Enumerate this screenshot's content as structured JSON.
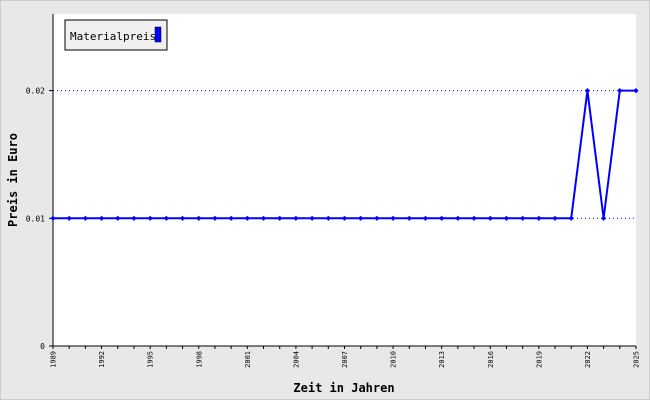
{
  "chart_data": {
    "type": "line",
    "title": "",
    "xlabel": "Zeit in Jahren",
    "ylabel": "Preis in Euro",
    "xlim": [
      1989,
      2025
    ],
    "ylim": [
      0,
      0.026
    ],
    "x_ticks": [
      "1989",
      "1992",
      "1995",
      "1998",
      "2001",
      "2004",
      "2007",
      "2010",
      "2013",
      "2016",
      "2019",
      "2022",
      "2025"
    ],
    "y_ticks": [
      "0",
      "0.01",
      "0.02"
    ],
    "y_tick_values": [
      0,
      0.01,
      0.02
    ],
    "grid": "horizontal-dotted",
    "legend_position": "top-left",
    "series": [
      {
        "name": "Materialpreis",
        "color": "#0000ff",
        "x": [
          1989,
          1990,
          1991,
          1992,
          1993,
          1994,
          1995,
          1996,
          1997,
          1998,
          1999,
          2000,
          2001,
          2002,
          2003,
          2004,
          2005,
          2006,
          2007,
          2008,
          2009,
          2010,
          2011,
          2012,
          2013,
          2014,
          2015,
          2016,
          2017,
          2018,
          2019,
          2020,
          2021,
          2022,
          2023,
          2024,
          2025
        ],
        "values": [
          0.01,
          0.01,
          0.01,
          0.01,
          0.01,
          0.01,
          0.01,
          0.01,
          0.01,
          0.01,
          0.01,
          0.01,
          0.01,
          0.01,
          0.01,
          0.01,
          0.01,
          0.01,
          0.01,
          0.01,
          0.01,
          0.01,
          0.01,
          0.01,
          0.01,
          0.01,
          0.01,
          0.01,
          0.01,
          0.01,
          0.01,
          0.01,
          0.01,
          0.02,
          0.01,
          0.02,
          0.02
        ]
      }
    ],
    "colors": {
      "outer_background": "#e8e8e8",
      "plot_background": "#ffffff",
      "line": "#0000ff",
      "grid": "#0000ff",
      "legend_background": "#f0f0f0"
    }
  }
}
